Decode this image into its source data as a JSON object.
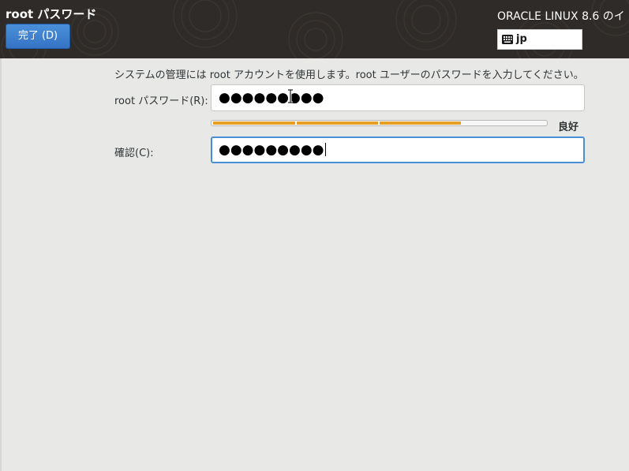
{
  "header": {
    "title": "root パスワード",
    "done_button_label": "完了 (D)",
    "product_name": "ORACLE LINUX 8.6 のイ",
    "keyboard_icon": "keyboard-icon",
    "keyboard_layout": "jp"
  },
  "main": {
    "description": "システムの管理には root アカウントを使用します。root ユーザーのパスワードを入力してください。",
    "password_label": "root パスワード(R):",
    "password_value": "●●●●●●●●●",
    "confirm_label": "確認(C):",
    "confirm_value": "●●●●●●●●●",
    "strength": {
      "label": "良好",
      "level": 0.75,
      "segments_filled": 3,
      "segments_total": 4,
      "color": "#e69f23"
    }
  },
  "colors": {
    "header_bg": "#2f2b28",
    "page_bg": "#e8e8e7",
    "accent": "#4a90d9"
  }
}
